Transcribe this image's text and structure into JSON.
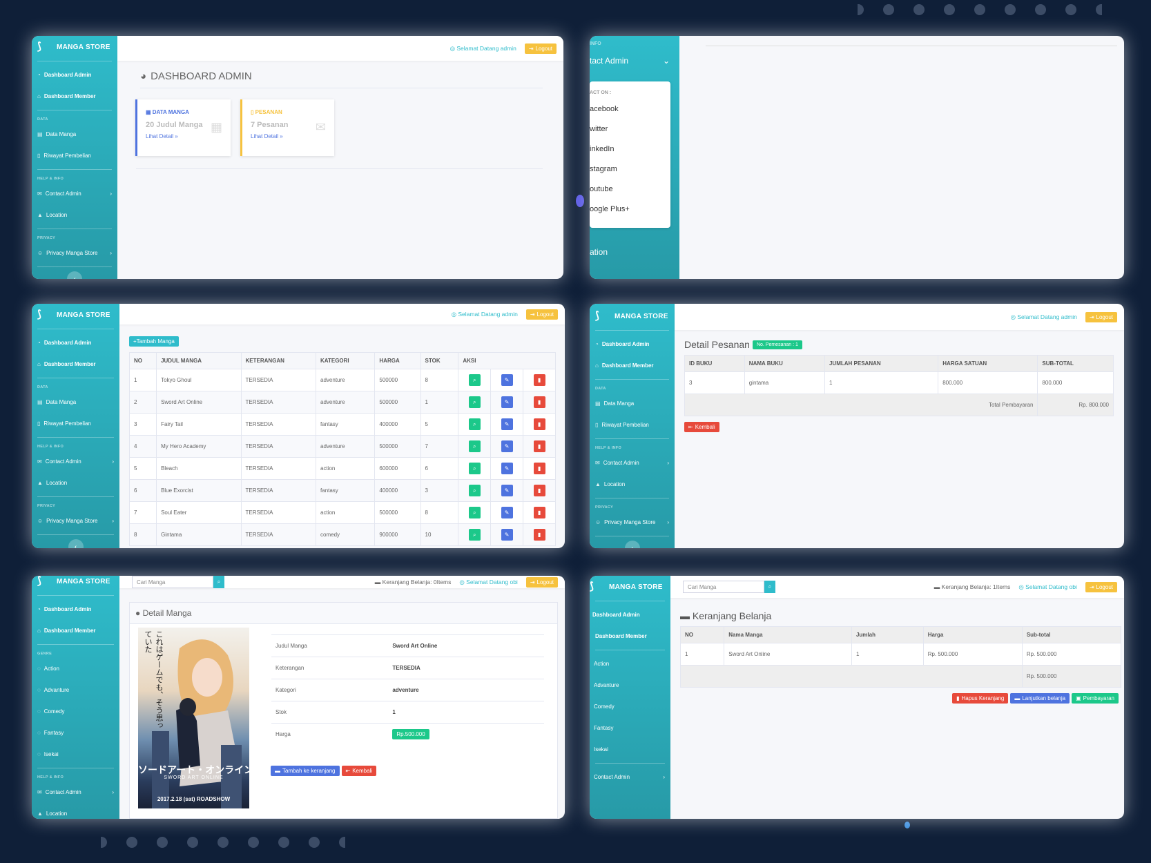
{
  "brand": "MANGA STORE",
  "welcome_admin": "Selamat Datang admin",
  "welcome_obi": "Selamat Datang obi",
  "logout": "Logout",
  "search_placeholder": "Cari Manga",
  "cart_empty": "Keranjang Belanja: 0Items",
  "cart_one": "Keranjang Belanja: 1Items",
  "nav_admin": {
    "dashboard_admin": "Dashboard Admin",
    "dashboard_member": "Dashboard Member",
    "data_header": "DATA",
    "data_manga": "Data Manga",
    "riwayat": "Riwayat Pembelian",
    "help_header": "HELP & INFO",
    "contact": "Contact Admin",
    "location": "Location",
    "privacy_header": "PRIVACY",
    "privacy": "Privacy Manga Store"
  },
  "nav_genre": {
    "genre_header": "GENRE",
    "action": "Action",
    "adventure": "Advanture",
    "comedy": "Comedy",
    "fantasy": "Fantasy",
    "isekai": "Isekai"
  },
  "dashboard": {
    "title": "DASHBOARD ADMIN",
    "card1_title": "DATA MANGA",
    "card1_value": "20 Judul Manga",
    "card1_link": "Lihat Detail",
    "card2_title": "PESANAN",
    "card2_value": "7 Pesanan",
    "card2_link": "Lihat Detail"
  },
  "contact_menu": {
    "info_header": "INFO",
    "contact": "tact Admin",
    "contact_on": "ACT ON :",
    "items": [
      "acebook",
      "witter",
      "inkedIn",
      "stagram",
      "outube",
      "oogle Plus+"
    ],
    "location": "ation"
  },
  "manga_table": {
    "add_button": "+Tambah Manga",
    "headers": [
      "NO",
      "JUDUL MANGA",
      "KETERANGAN",
      "KATEGORI",
      "HARGA",
      "STOK",
      "AKSI"
    ],
    "rows": [
      [
        "1",
        "Tokyo Ghoul",
        "TERSEDIA",
        "adventure",
        "500000",
        "8"
      ],
      [
        "2",
        "Sword Art Online",
        "TERSEDIA",
        "adventure",
        "500000",
        "1"
      ],
      [
        "3",
        "Fairy Tail",
        "TERSEDIA",
        "fantasy",
        "400000",
        "5"
      ],
      [
        "4",
        "My Hero Academy",
        "TERSEDIA",
        "adventure",
        "500000",
        "7"
      ],
      [
        "5",
        "Bleach",
        "TERSEDIA",
        "action",
        "600000",
        "6"
      ],
      [
        "6",
        "Blue Exorcist",
        "TERSEDIA",
        "fantasy",
        "400000",
        "3"
      ],
      [
        "7",
        "Soul Eater",
        "TERSEDIA",
        "action",
        "500000",
        "8"
      ],
      [
        "8",
        "Gintama",
        "TERSEDIA",
        "comedy",
        "900000",
        "10"
      ]
    ]
  },
  "detail_pesanan": {
    "title": "Detail Pesanan",
    "badge": "No. Pemesanan : 1",
    "headers": [
      "ID BUKU",
      "NAMA BUKU",
      "JUMLAH PESANAN",
      "HARGA SATUAN",
      "SUB-TOTAL"
    ],
    "row": [
      "3",
      "gintama",
      "1",
      "800.000",
      "800.000"
    ],
    "total_label": "Total Pembayaran",
    "total_value": "Rp. 800.000",
    "back": "Kembali"
  },
  "detail_manga": {
    "title": "Detail Manga",
    "labels": [
      "Judul Manga",
      "Keterangan",
      "Kategori",
      "Stok",
      "Harga"
    ],
    "values": [
      "Sword Art Online",
      "TERSEDIA",
      "adventure",
      "1"
    ],
    "price": "Rp.500.000",
    "add_cart": "Tambah ke keranjang",
    "back": "Kembali",
    "poster_title": "ソードアート・オンライン",
    "poster_subtitle": "SWORD ART ONLINE",
    "poster_date": "2017.2.18 (sat) ROADSHOW",
    "poster_vertical": "これはゲームでも、そう思っていた"
  },
  "cart": {
    "title": "Keranjang Belanja",
    "headers": [
      "NO",
      "Nama Manga",
      "Jumlah",
      "Harga",
      "Sub-total"
    ],
    "row": [
      "1",
      "Sword Art Online",
      "1",
      "Rp. 500.000",
      "Rp. 500.000"
    ],
    "total": "Rp. 500.000",
    "clear": "Hapus Keranjang",
    "continue": "Lanjutkan belanja",
    "pay": "Pembayaran"
  },
  "colors": {
    "teal": "#2fbccb",
    "yellow": "#f6c23e",
    "red": "#e74a3b",
    "blue": "#4e73df",
    "green": "#1cc88a",
    "background": "#0f1f38"
  }
}
